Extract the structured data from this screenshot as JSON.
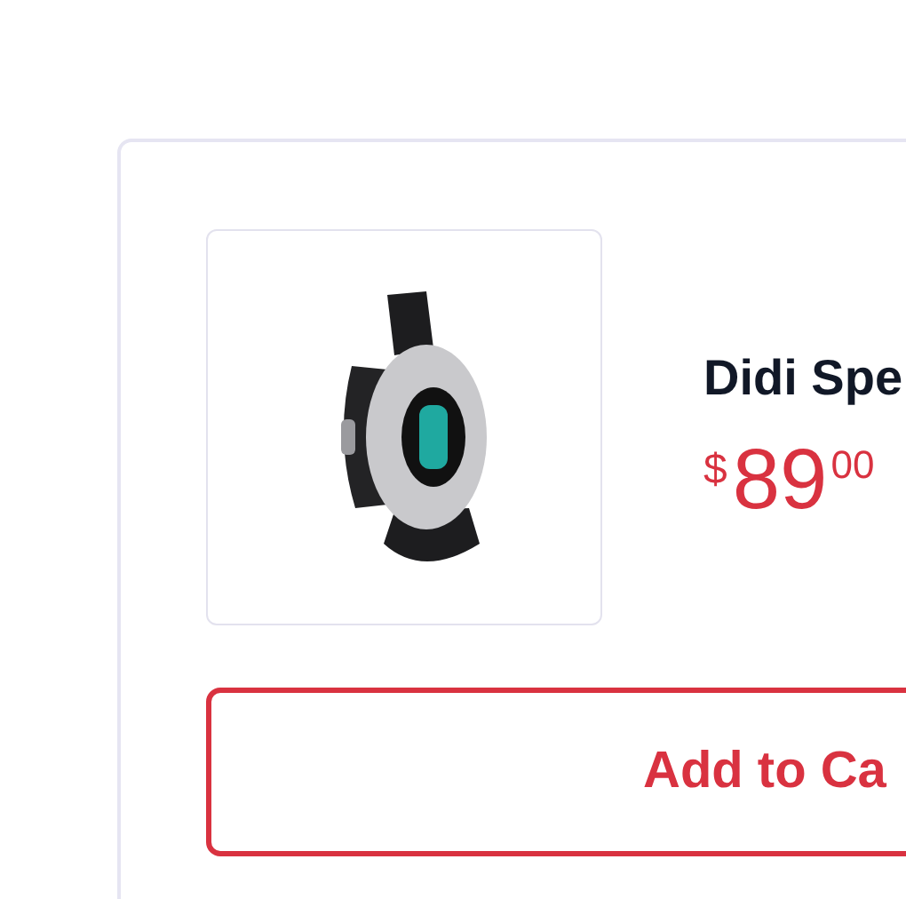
{
  "product": {
    "title": "Didi Spe",
    "price": {
      "currency": "$",
      "whole": "89",
      "cents": "00"
    }
  },
  "button": {
    "label": "Add to Ca"
  }
}
